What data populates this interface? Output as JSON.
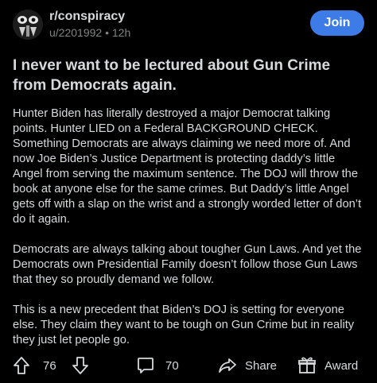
{
  "header": {
    "subreddit": "r/conspiracy",
    "author": "u/2201992",
    "separator": "•",
    "age": "12h",
    "join_label": "Join"
  },
  "post": {
    "title": "I never want to be lectured about Gun Crime from Democrats again.",
    "paragraphs": [
      "Hunter Biden has literally destroyed a major Democrat talking points. Hunter LIED on a Federal BACKGROUND CHECK. Something Democrats are always claiming we need more of. And now Joe Biden’s Justice Department is protecting daddy’s little Angel from serving the maximum sentence. The DOJ will throw the book at anyone else for the same crimes. But Daddy’s little Angel gets off with a slap on the wrist and a strongly worded letter of don’t do it again.",
      "Democrats are always talking about tougher Gun Laws. And yet the Democrats own Presidential Family doesn’t follow those Gun Laws that they so proudly demand we follow.",
      "This is a new precedent that Biden’s DOJ is setting for everyone else. They claim they want to be tough on Gun Crime but in reality they just let people go."
    ]
  },
  "actions": {
    "vote_count": "76",
    "comment_count": "70",
    "share_label": "Share",
    "award_label": "Award"
  },
  "colors": {
    "background": "#000000",
    "text": "#d7dadc",
    "muted": "#818384",
    "join_button": "#3d7ce6"
  },
  "icons": {
    "avatar": "subreddit-avatar-icon",
    "upvote": "upvote-arrow-icon",
    "downvote": "downvote-arrow-icon",
    "comment": "comment-bubble-icon",
    "share": "share-arrow-icon",
    "award": "award-gift-icon"
  }
}
